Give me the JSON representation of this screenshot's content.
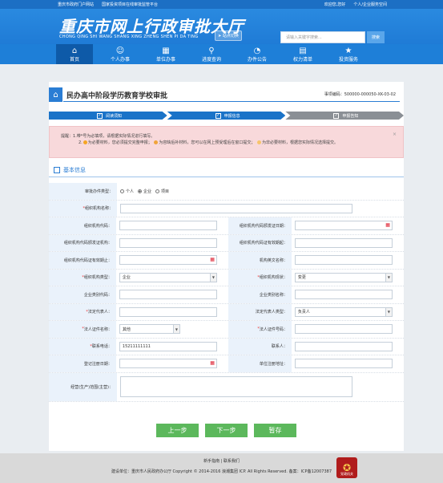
{
  "topbar": {
    "left1": "重庆市政府门户网站",
    "left2": "国家投资项目在线审批监管平台",
    "right1": "欢迎您,您好",
    "right2": "个人/企业服务空间"
  },
  "header": {
    "title": "重庆市网上行政审批大厅",
    "pinyin": "CHONG QING SHI WANG SHANG XING ZHENG SHEN PI DA TING",
    "site_btn": "站点切换",
    "search_placeholder": "请输入关键字搜索...",
    "search_btn": "搜索"
  },
  "nav": [
    {
      "label": "首页",
      "icon": "home-icon",
      "glyph": "⌂"
    },
    {
      "label": "个人办事",
      "icon": "person-icon",
      "glyph": "☺"
    },
    {
      "label": "单位办事",
      "icon": "building-icon",
      "glyph": "▦"
    },
    {
      "label": "进度查询",
      "icon": "search-icon",
      "glyph": "⚲"
    },
    {
      "label": "办件公告",
      "icon": "megaphone-icon",
      "glyph": "◔"
    },
    {
      "label": "权力清单",
      "icon": "list-icon",
      "glyph": "▤"
    },
    {
      "label": "投资服务",
      "icon": "star-icon",
      "glyph": "★"
    }
  ],
  "page": {
    "title": "民办高中阶段学历教育学校审批",
    "code_label": "事项编码：",
    "code": "500000-000050-XK-03-02"
  },
  "steps": [
    "阅读须知",
    "申报信息",
    "申报告知"
  ],
  "notice": {
    "lead": "提醒：",
    "line1": "1.带*号为必填项，请根据实际情况进行填写。",
    "line2a": "2.",
    "line2b": "为必要材料，您必须提交完整申报；",
    "line2c": "为容缺后补材料，您可以在网上预受理后在窗口提交；",
    "line2d": "为非必要材料，根据您实际情况选择提交。"
  },
  "section": {
    "title": "基本信息"
  },
  "form": {
    "applicant_type_label": "审批办件类型：",
    "applicant_type_options": [
      "个人",
      "企业",
      "项目"
    ],
    "org_name_label": "组织机构名称：",
    "org_code_label": "组织机构代码：",
    "org_code_issue_date_label": "组织机构代码颁发证日期：",
    "org_code_issuer_label": "组织机构代码颁发证机构：",
    "org_code_valid_from_label": "组织机构代码证有效期起：",
    "org_code_valid_to_label": "组织机构代码证有效期止：",
    "org_en_name_label": "机构英文名称：",
    "org_type_label": "组织机构类型：",
    "org_type_value": "企业",
    "org_status_label": "组织机构现状：",
    "org_status_value": "变更",
    "enterprise_type_code_label": "企业类别代码：",
    "enterprise_type_name_label": "企业类别名称：",
    "legal_rep_label": "法定代表人：",
    "legal_rep_type_label": "法定代表人类型：",
    "legal_rep_type_value": "负责人",
    "legal_id_type_label": "法人证件名称：",
    "legal_id_type_value": "其他",
    "legal_id_no_label": "法人证件号码：",
    "contact_phone_label": "联系电话：",
    "contact_phone_value": "15211111111",
    "contact_person_label": "联系人：",
    "reg_date_label": "登记注册日期：",
    "reg_address_label": "单位注册地址：",
    "business_scope_label": "经营(生产)范围(主营)："
  },
  "buttons": {
    "prev": "上一步",
    "next": "下一步",
    "save": "暂存"
  },
  "footer": {
    "links": "新手指南 | 联系我们",
    "copyright": "建设单位：重庆市人民政府办公厅     Copyright © 2014-2016 浪潮集团 ICP. All Rights Reserved.     备案：ICP备12007387",
    "badge": "党政机关"
  }
}
